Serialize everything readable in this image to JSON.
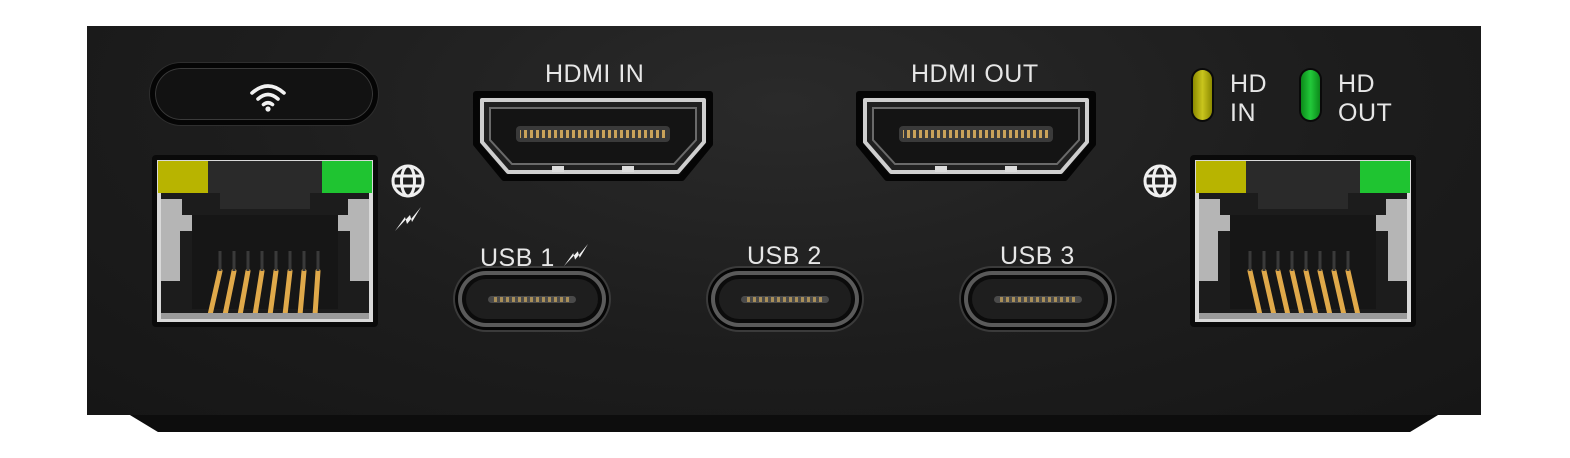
{
  "device": {
    "wifi_button": {
      "icon": "wifi-icon"
    },
    "ports": {
      "hdmi_in": {
        "label": "HDMI IN"
      },
      "hdmi_out": {
        "label": "HDMI OUT"
      },
      "usb1": {
        "label": "USB 1",
        "icon": "power-bolt-icon"
      },
      "usb2": {
        "label": "USB 2"
      },
      "usb3": {
        "label": "USB 3"
      },
      "ethernet_left": {
        "icons": [
          "globe-icon",
          "power-bolt-icon"
        ]
      },
      "ethernet_right": {
        "icons": [
          "globe-icon"
        ]
      }
    },
    "indicators": {
      "hd_in": {
        "line1": "HD",
        "line2": "IN",
        "color": "#c9c51d"
      },
      "hd_out": {
        "line1": "HD",
        "line2": "OUT",
        "color": "#22c93a"
      }
    },
    "colors": {
      "panel": "#1d1d1d",
      "ethernet_led_yellow": "#b8b400",
      "ethernet_led_green": "#1fc431",
      "pin_gold": "#e0a94a"
    }
  }
}
